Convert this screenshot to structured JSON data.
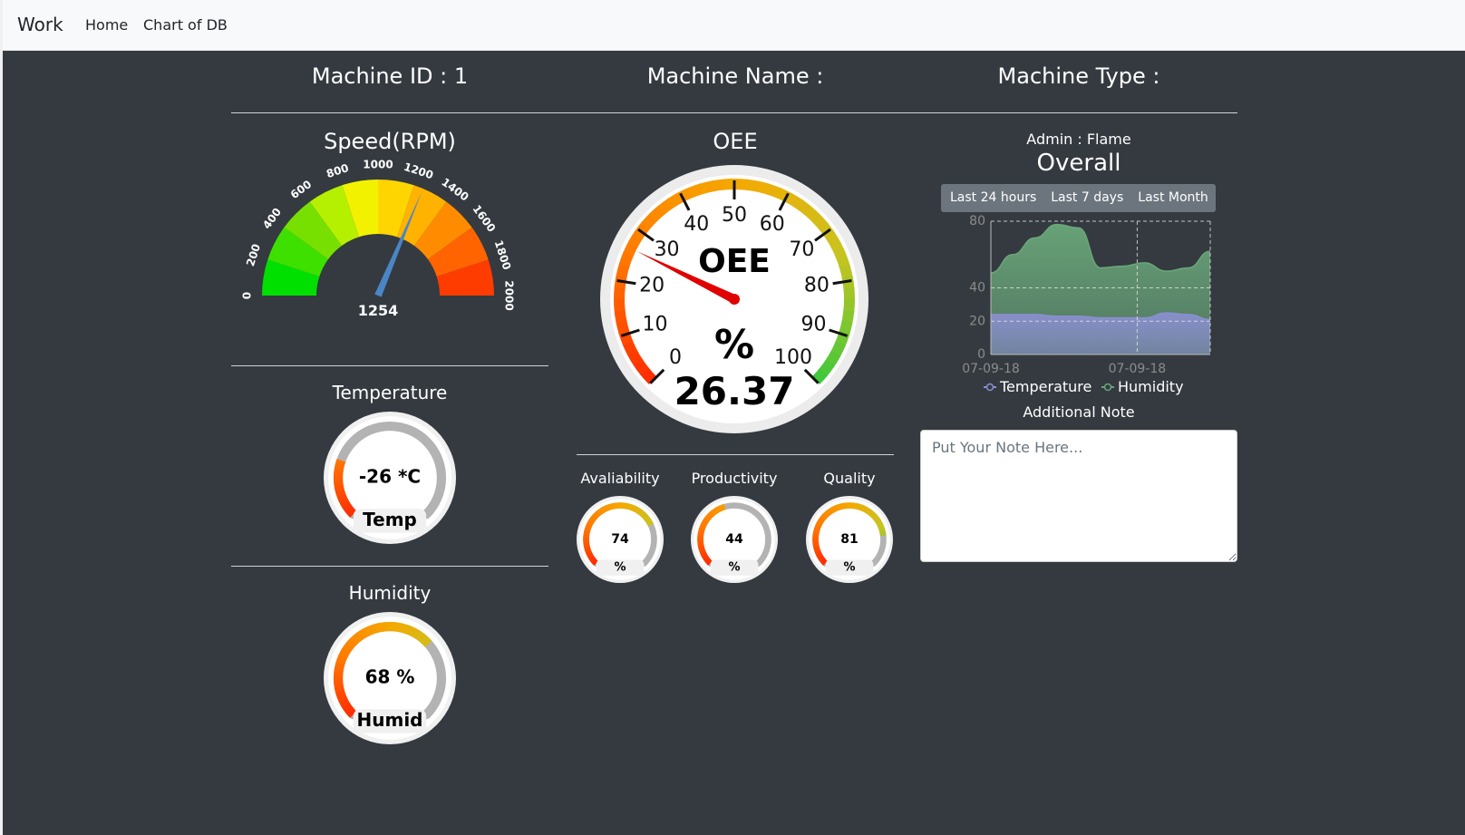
{
  "navbar": {
    "brand": "Work",
    "links": [
      "Home",
      "Chart of DB"
    ]
  },
  "machine": {
    "id_label": "Machine ID : 1",
    "name_label": "Machine Name :",
    "type_label": "Machine Type :"
  },
  "speed": {
    "title": "Speed(RPM)",
    "value": 1254,
    "value_label": "1254",
    "min": 0,
    "max": 2000,
    "ticks": [
      "0",
      "200",
      "400",
      "600",
      "800",
      "1000",
      "1200",
      "1400",
      "1600",
      "1800",
      "2000"
    ],
    "band_colors": [
      "#00e000",
      "#3ee000",
      "#77e000",
      "#b5f000",
      "#f2f200",
      "#ffd500",
      "#ffb300",
      "#ff8c00",
      "#ff6400",
      "#ff3c00"
    ],
    "needle_color": "#4a86c6"
  },
  "oee": {
    "title": "OEE",
    "center_label": "OEE",
    "unit": "%",
    "value": 26.37,
    "value_label": "26.37",
    "ticks": [
      "0",
      "10",
      "20",
      "30",
      "40",
      "50",
      "60",
      "70",
      "80",
      "90",
      "100"
    ],
    "needle_color": "#e00000"
  },
  "temperature": {
    "title": "Temperature",
    "value": -26,
    "min": -50,
    "max": 50,
    "value_label": "-26 *C",
    "footer": "Temp"
  },
  "humidity": {
    "title": "Humidity",
    "value": 68,
    "min": 0,
    "max": 100,
    "value_label": "68 %",
    "footer": "Humid"
  },
  "kpis": [
    {
      "title": "Avaliability",
      "value": 74,
      "value_label": "74",
      "unit": "%"
    },
    {
      "title": "Productivity",
      "value": 44,
      "value_label": "44",
      "unit": "%"
    },
    {
      "title": "Quality",
      "value": 81,
      "value_label": "81",
      "unit": "%"
    }
  ],
  "overall": {
    "admin": "Admin : Flame",
    "title": "Overall",
    "tabs": [
      "Last 24 hours",
      "Last 7 days",
      "Last Month"
    ],
    "additional_note": "Additional Note",
    "note_placeholder": "Put Your Note Here..."
  },
  "chart_data": {
    "type": "area",
    "title": "",
    "xlabel": "",
    "ylabel": "",
    "x_ticks": [
      "07-09-18",
      "07-09-18"
    ],
    "y_ticks": [
      "0",
      "20",
      "40",
      "80"
    ],
    "ylim": [
      0,
      80
    ],
    "grid": true,
    "legend": "bottom",
    "series": [
      {
        "name": "Temperature",
        "color": "#8a8fd0",
        "x": [
          0,
          0.1,
          0.2,
          0.3,
          0.4,
          0.5,
          0.6,
          0.7,
          0.8,
          0.9,
          1.0
        ],
        "values": [
          24,
          24,
          24,
          23,
          23,
          22,
          22,
          22,
          25,
          24,
          21
        ]
      },
      {
        "name": "Humidity",
        "color": "#6aa77a",
        "x": [
          0,
          0.1,
          0.2,
          0.3,
          0.4,
          0.5,
          0.6,
          0.7,
          0.8,
          0.9,
          1.0
        ],
        "values": [
          49,
          60,
          70,
          78,
          76,
          52,
          53,
          55,
          50,
          52,
          62
        ]
      }
    ]
  }
}
